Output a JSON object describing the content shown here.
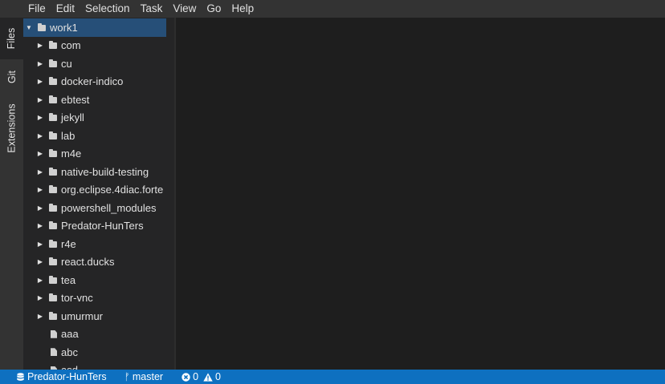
{
  "menu": [
    "File",
    "Edit",
    "Selection",
    "Task",
    "View",
    "Go",
    "Help"
  ],
  "activity_tabs": [
    "Files",
    "Git",
    "Extensions"
  ],
  "tree": {
    "root": "work1",
    "folders": [
      "com",
      "cu",
      "docker-indico",
      "ebtest",
      "jekyll",
      "lab",
      "m4e",
      "native-build-testing",
      "org.eclipse.4diac.forte",
      "powershell_modules",
      "Predator-HunTers",
      "r4e",
      "react.ducks",
      "tea",
      "tor-vnc",
      "umurmur"
    ],
    "files": [
      "aaa",
      "abc",
      "asd"
    ]
  },
  "status": {
    "workspace": "Predator-HunTers",
    "branch": "master",
    "errors": "0",
    "warnings": "0"
  },
  "colors": {
    "accent": "#0e70c0",
    "selection": "#264f78"
  }
}
